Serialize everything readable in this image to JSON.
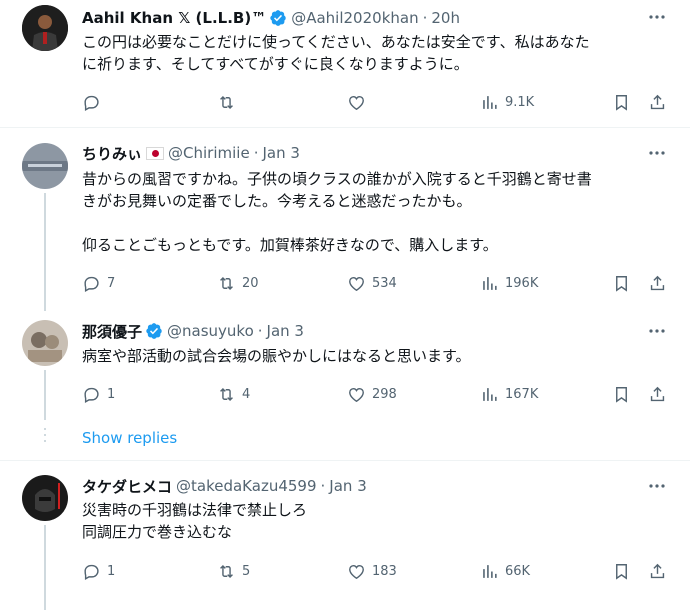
{
  "posts": [
    {
      "name": "Aahil Khan 𝕏 (L.L.B)™",
      "handle": "@Aahil2020khan",
      "time": "20h",
      "verified": true,
      "text": [
        "この円は必要なことだけに使ってください、あなたは安全です、私はあなた",
        "に祈ります、そしてすべてがすぐに良くなりますように。"
      ],
      "replies": "",
      "reposts": "",
      "likes": "",
      "views": "9.1K"
    },
    {
      "name": "ちりみぃ",
      "handle": "@Chirimiie",
      "time": "Jan 3",
      "verified": false,
      "flag": "japan-flag",
      "text": [
        "昔からの風習ですかね。子供の頃クラスの誰かが入院すると千羽鶴と寄せ書",
        "きがお見舞いの定番でした。今考えると迷惑だったかも。",
        "",
        "仰ることごもっともです。加賀棒茶好きなので、購入します。"
      ],
      "replies": "7",
      "reposts": "20",
      "likes": "534",
      "views": "196K"
    },
    {
      "name": "那須優子",
      "handle": "@nasuyuko",
      "time": "Jan 3",
      "verified": true,
      "text": [
        "病室や部活動の試合会場の賑やかしにはなると思います。"
      ],
      "replies": "1",
      "reposts": "4",
      "likes": "298",
      "views": "167K"
    },
    {
      "name": "タケダヒメコ",
      "handle": "@takedaKazu4599",
      "time": "Jan 3",
      "verified": false,
      "text": [
        "災害時の千羽鶴は法律で禁止しろ",
        "同調圧力で巻き込むな"
      ],
      "replies": "1",
      "reposts": "5",
      "likes": "183",
      "views": "66K"
    }
  ],
  "show_replies_label": "Show replies",
  "colors": {
    "accent": "#1d9bf0",
    "secondary_text": "#536471",
    "divider": "#eff3f4"
  }
}
